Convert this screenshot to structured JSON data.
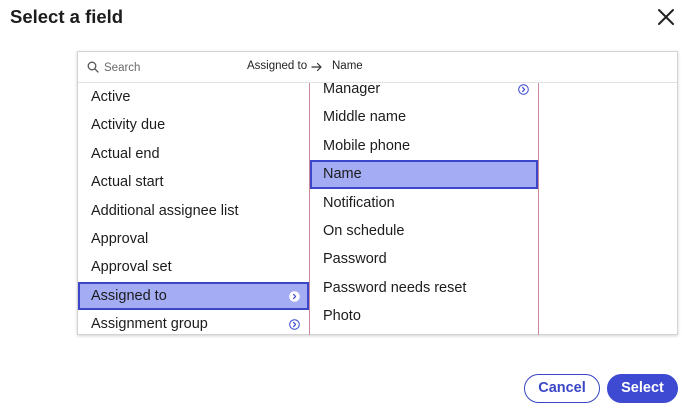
{
  "dialog": {
    "title": "Select a field",
    "cancel_label": "Cancel",
    "select_label": "Select"
  },
  "search": {
    "placeholder": "Search",
    "value": ""
  },
  "breadcrumb": [
    "Assigned to",
    "Name"
  ],
  "columns": [
    {
      "items": [
        {
          "label": "Active",
          "has_children": false,
          "selected": false
        },
        {
          "label": "Activity due",
          "has_children": false,
          "selected": false
        },
        {
          "label": "Actual end",
          "has_children": false,
          "selected": false
        },
        {
          "label": "Actual start",
          "has_children": false,
          "selected": false
        },
        {
          "label": "Additional assignee list",
          "has_children": false,
          "selected": false
        },
        {
          "label": "Approval",
          "has_children": false,
          "selected": false
        },
        {
          "label": "Approval set",
          "has_children": false,
          "selected": false
        },
        {
          "label": "Assigned to",
          "has_children": true,
          "selected": true
        },
        {
          "label": "Assignment group",
          "has_children": true,
          "selected": false
        }
      ]
    },
    {
      "items": [
        {
          "label": "Manager",
          "has_children": true,
          "selected": false
        },
        {
          "label": "Middle name",
          "has_children": false,
          "selected": false
        },
        {
          "label": "Mobile phone",
          "has_children": false,
          "selected": false
        },
        {
          "label": "Name",
          "has_children": false,
          "selected": true
        },
        {
          "label": "Notification",
          "has_children": false,
          "selected": false
        },
        {
          "label": "On schedule",
          "has_children": false,
          "selected": false
        },
        {
          "label": "Password",
          "has_children": false,
          "selected": false
        },
        {
          "label": "Password needs reset",
          "has_children": false,
          "selected": false
        },
        {
          "label": "Photo",
          "has_children": false,
          "selected": false
        }
      ]
    }
  ],
  "icons": {
    "close": "close-icon",
    "search": "search-icon",
    "breadcrumb_separator": "arrow-right-icon",
    "expand": "chevron-right-circle-icon"
  },
  "colors": {
    "accent": "#3d4ad1",
    "selected_fill": "#a4acf4",
    "selected_border": "#3b47c8",
    "column_divider": "#c98aa0"
  }
}
